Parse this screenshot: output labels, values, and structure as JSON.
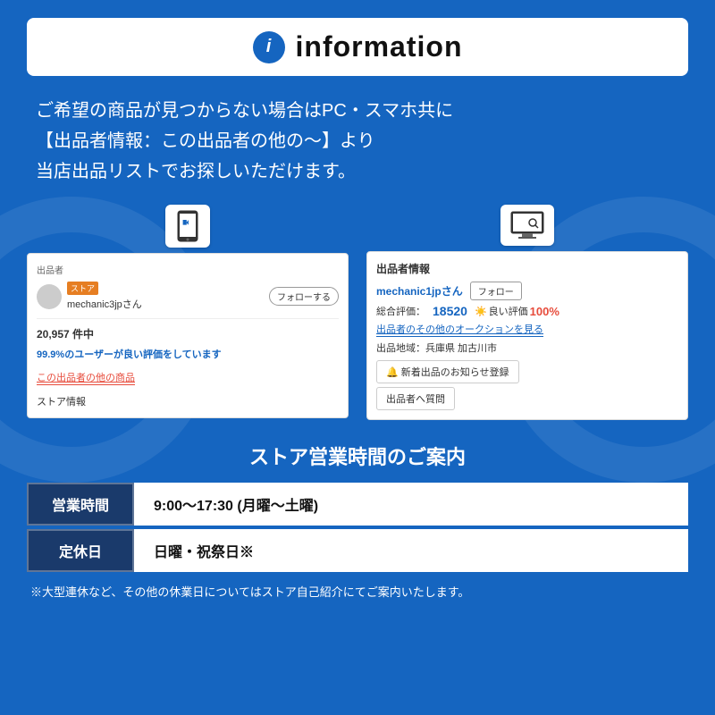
{
  "header": {
    "icon_label": "i",
    "title": "information"
  },
  "description": {
    "line1": "ご希望の商品が見つからない場合はPC・スマホ共に",
    "line2": "【出品者情報：この出品者の他の〜】より",
    "line3": "当店出品リストでお探しいただけます。"
  },
  "mobile_screenshot": {
    "seller_label": "出品者",
    "store_badge": "ストア",
    "seller_name": "mechanic3jpさん",
    "follow_button": "フォローする",
    "count_label": "20,957 件中",
    "rating_text": "99.9%のユーザーが良い評価をしています",
    "link_text": "この出品者の他の商品",
    "store_info": "ストア情報"
  },
  "desktop_screenshot": {
    "title": "出品者情報",
    "seller_name": "mechanic1jpさん",
    "follow_button": "フォロー",
    "total_rating_label": "総合評価：",
    "total_rating_value": "18520",
    "good_rating_label": "良い評価",
    "good_rating_value": "100%",
    "auction_link": "出品者のその他のオークションを見る",
    "location_label": "出品地域：兵庫県 加古川市",
    "notify_button": "🔔 新着出品のお知らせ登録",
    "question_button": "出品者へ質問"
  },
  "store_hours": {
    "title": "ストア営業時間のご案内",
    "rows": [
      {
        "label": "営業時間",
        "value": "9:00〜17:30 (月曜〜土曜)"
      },
      {
        "label": "定休日",
        "value": "日曜・祝祭日※"
      }
    ],
    "footer_note": "※大型連休など、その他の休業日についてはストア自己紹介にてご案内いたします。"
  }
}
